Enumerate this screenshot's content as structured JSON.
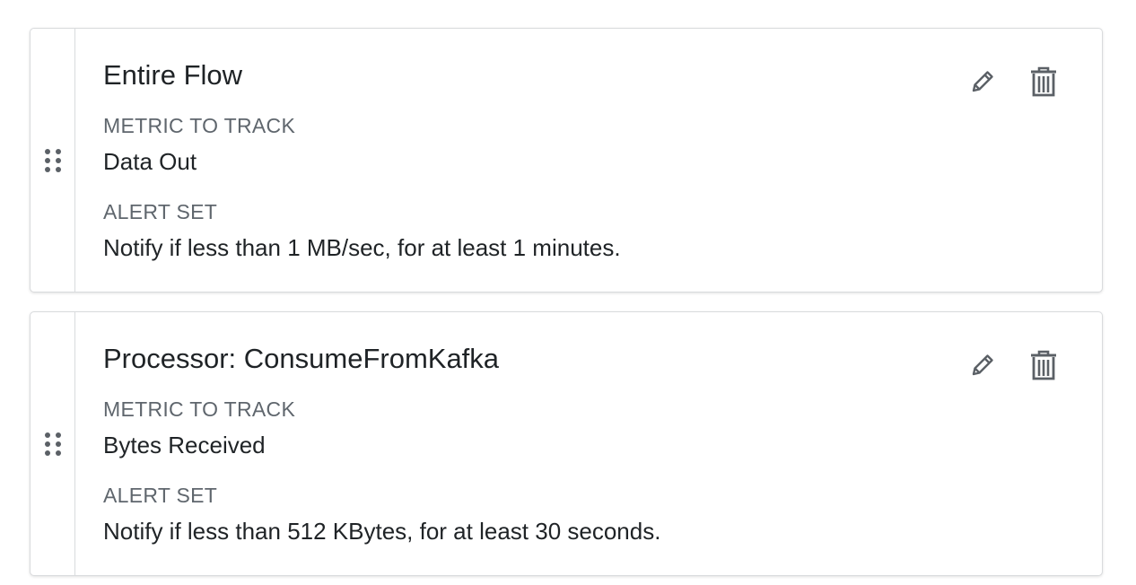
{
  "alerts": [
    {
      "title": "Entire Flow",
      "metric_label": "METRIC TO TRACK",
      "metric_value": "Data Out",
      "alert_label": "ALERT SET",
      "alert_value": "Notify if less than 1 MB/sec, for at least 1 minutes.",
      "icons": {
        "drag": "drag-handle-icon",
        "edit": "pencil-icon",
        "delete": "trash-icon"
      }
    },
    {
      "title": "Processor: ConsumeFromKafka",
      "metric_label": "METRIC TO TRACK",
      "metric_value": "Bytes Received",
      "alert_label": "ALERT SET",
      "alert_value": "Notify if less than 512 KBytes, for at least 30 seconds.",
      "icons": {
        "drag": "drag-handle-icon",
        "edit": "pencil-icon",
        "delete": "trash-icon"
      }
    }
  ],
  "colors": {
    "text": "#1f2326",
    "label": "#5f666d",
    "icon": "#5b6066",
    "border": "#d9dbdd"
  }
}
